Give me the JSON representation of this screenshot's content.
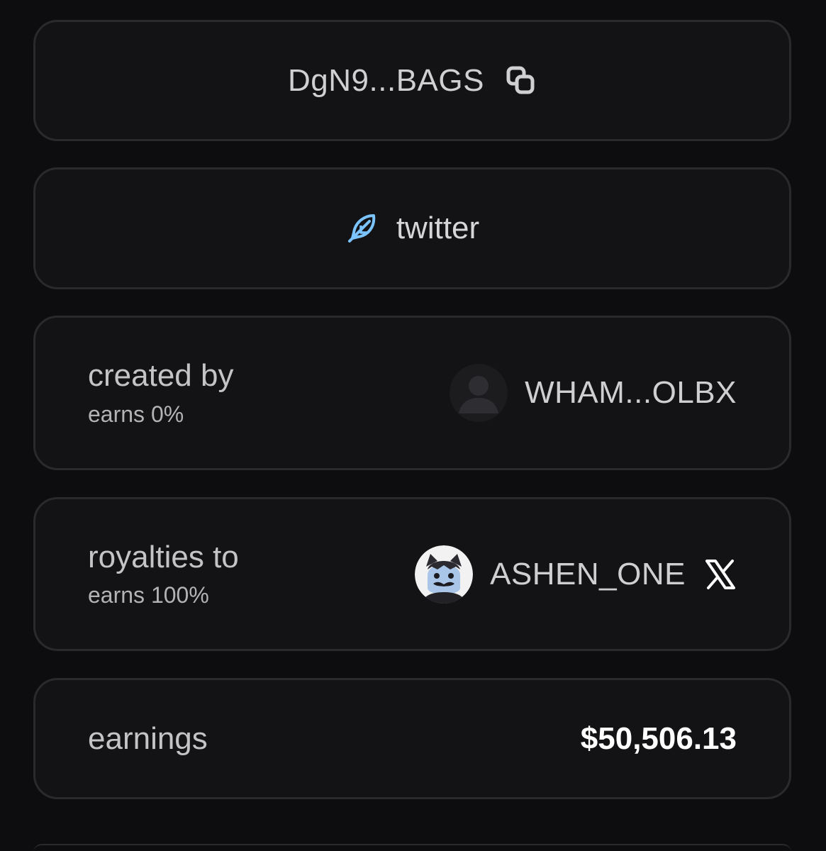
{
  "address": {
    "text": "DgN9...BAGS",
    "copy_icon": "copy-icon"
  },
  "social": {
    "label": "twitter",
    "icon": "feather-icon",
    "icon_color": "#7cc4ff"
  },
  "creator": {
    "label": "created by",
    "earns": "earns 0%",
    "username": "WHAM...OLBX",
    "avatar": "default-avatar-icon"
  },
  "royalties": {
    "label": "royalties to",
    "earns": "earns 100%",
    "username": "ASHEN_ONE",
    "avatar": "ashen-avatar",
    "platform_icon": "x-icon"
  },
  "earnings": {
    "label": "earnings",
    "value": "$50,506.13"
  }
}
